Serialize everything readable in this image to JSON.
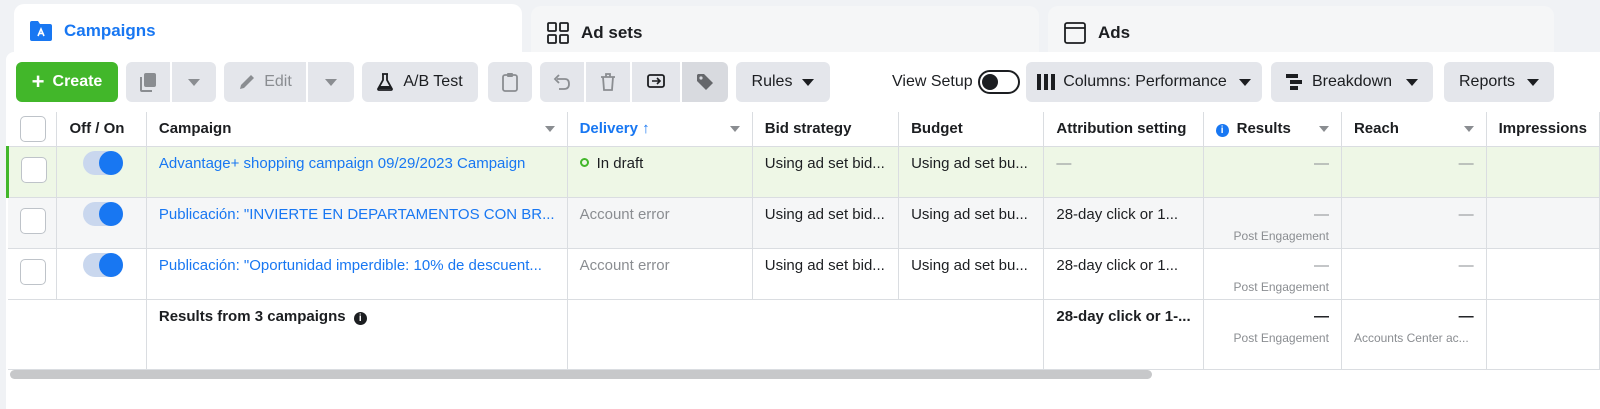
{
  "tabs": [
    {
      "label": "Campaigns",
      "icon": "folder-icon",
      "active": true
    },
    {
      "label": "Ad sets",
      "icon": "grid-icon",
      "active": false
    },
    {
      "label": "Ads",
      "icon": "window-icon",
      "active": false
    }
  ],
  "toolbar": {
    "create_label": "Create",
    "edit_label": "Edit",
    "ab_test_label": "A/B Test",
    "rules_label": "Rules",
    "view_setup_label": "View Setup",
    "columns_label": "Columns: Performance",
    "breakdown_label": "Breakdown",
    "reports_label": "Reports"
  },
  "table": {
    "headers": {
      "off_on": "Off / On",
      "campaign": "Campaign",
      "delivery": "Delivery",
      "delivery_sort": "↑",
      "bid_strategy": "Bid strategy",
      "budget": "Budget",
      "attribution": "Attribution setting",
      "results": "Results",
      "reach": "Reach",
      "impressions": "Impressions"
    },
    "rows": [
      {
        "campaign": "Advantage+ shopping campaign 09/29/2023 Campaign",
        "delivery": "In draft",
        "bid": "Using ad set bid...",
        "budget": "Using ad set bu...",
        "attribution": "—",
        "results": "—",
        "results_sub": "",
        "reach": "—"
      },
      {
        "campaign": "Publicación: \"INVIERTE EN DEPARTAMENTOS CON BR...",
        "delivery": "Account error",
        "bid": "Using ad set bid...",
        "budget": "Using ad set bu...",
        "attribution": "28-day click or 1...",
        "results": "—",
        "results_sub": "Post Engagement",
        "reach": "—"
      },
      {
        "campaign": "Publicación: \"Oportunidad imperdible: 10% de descuent...",
        "delivery": "Account error",
        "bid": "Using ad set bid...",
        "budget": "Using ad set bu...",
        "attribution": "28-day click or 1...",
        "results": "—",
        "results_sub": "Post Engagement",
        "reach": "—"
      }
    ],
    "summary": {
      "label": "Results from 3 campaigns",
      "attribution": "28-day click or 1-...",
      "results": "—",
      "results_sub": "Post Engagement",
      "reach": "—",
      "reach_sub": "Accounts Center ac..."
    }
  },
  "colors": {
    "accent": "#1877f2",
    "create": "#42b72a",
    "draft_row": "#eef7e6"
  }
}
